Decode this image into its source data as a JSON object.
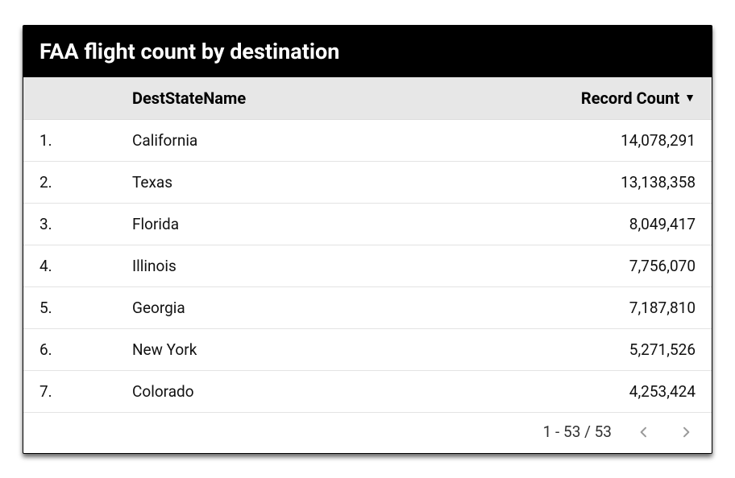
{
  "title": "FAA flight count by destination",
  "columns": {
    "name": "DestStateName",
    "count": "Record Count"
  },
  "rows": [
    {
      "rank": "1.",
      "name": "California",
      "count": "14,078,291"
    },
    {
      "rank": "2.",
      "name": "Texas",
      "count": "13,138,358"
    },
    {
      "rank": "3.",
      "name": "Florida",
      "count": "8,049,417"
    },
    {
      "rank": "4.",
      "name": "Illinois",
      "count": "7,756,070"
    },
    {
      "rank": "5.",
      "name": "Georgia",
      "count": "7,187,810"
    },
    {
      "rank": "6.",
      "name": "New York",
      "count": "5,271,526"
    },
    {
      "rank": "7.",
      "name": "Colorado",
      "count": "4,253,424"
    }
  ],
  "pager": {
    "range": "1 - 53 / 53"
  },
  "chart_data": {
    "type": "table",
    "title": "FAA flight count by destination",
    "columns": [
      "DestStateName",
      "Record Count"
    ],
    "sort": {
      "column": "Record Count",
      "direction": "desc"
    },
    "total_rows": 53,
    "visible_range": "1 - 53 / 53",
    "rows": [
      {
        "DestStateName": "California",
        "Record Count": 14078291
      },
      {
        "DestStateName": "Texas",
        "Record Count": 13138358
      },
      {
        "DestStateName": "Florida",
        "Record Count": 8049417
      },
      {
        "DestStateName": "Illinois",
        "Record Count": 7756070
      },
      {
        "DestStateName": "Georgia",
        "Record Count": 7187810
      },
      {
        "DestStateName": "New York",
        "Record Count": 5271526
      },
      {
        "DestStateName": "Colorado",
        "Record Count": 4253424
      }
    ]
  }
}
